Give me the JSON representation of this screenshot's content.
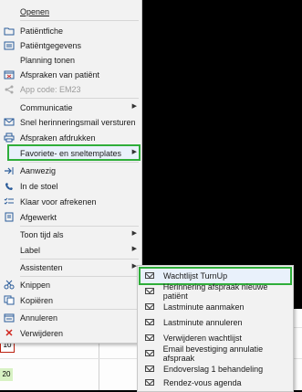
{
  "background": {
    "tag_red": "10",
    "tag_green": "20"
  },
  "menu": {
    "items": [
      {
        "label": "Openen",
        "icon": "none"
      },
      {
        "label": "Patiëntfiche",
        "icon": "folder-open-icon"
      },
      {
        "label": "Patiëntgegevens",
        "icon": "list-icon"
      },
      {
        "label": "Planning tonen",
        "icon": "none"
      },
      {
        "label": "Afspraken van patiënt",
        "icon": "calendar-icon"
      },
      {
        "label": "App code: EM23",
        "icon": "share-icon",
        "disabled": true
      },
      {
        "label": "Communicatie",
        "icon": "none"
      },
      {
        "label": "Snel herinneringsmail versturen",
        "icon": "mail-icon"
      },
      {
        "label": "Afspraken afdrukken",
        "icon": "print-icon"
      },
      {
        "label": "Favoriete- en sneltemplates",
        "icon": "none"
      },
      {
        "label": "Aanwezig",
        "icon": "arrow-in-icon"
      },
      {
        "label": "In de stoel",
        "icon": "phone-icon"
      },
      {
        "label": "Klaar voor afrekenen",
        "icon": "checklist-icon"
      },
      {
        "label": "Afgewerkt",
        "icon": "document-icon"
      },
      {
        "label": "Toon tijd als",
        "icon": "none"
      },
      {
        "label": "Label",
        "icon": "none"
      },
      {
        "label": "Assistenten",
        "icon": "none"
      },
      {
        "label": "Knippen",
        "icon": "scissors-icon"
      },
      {
        "label": "Kopiëren",
        "icon": "copy-icon"
      },
      {
        "label": "Annuleren",
        "icon": "calendar-cancel-icon"
      },
      {
        "label": "Verwijderen",
        "icon": "delete-x-icon"
      }
    ]
  },
  "submenu": {
    "items": [
      "Wachtlijst TurnUp",
      "Herinnering afspraak nieuwe patiënt",
      "Lastminute aanmaken",
      "Lastminute annuleren",
      "Verwijderen wachtlijst",
      "Email bevestiging annulatie afspraak",
      "Endoverslag 1 behandeling",
      "Rendez-vous agenda"
    ]
  },
  "colors": {
    "highlight_border": "#2fae3a",
    "menu_bg": "#f2f2f2",
    "icon_blue": "#2b5c9a",
    "delete_red": "#d0241c"
  }
}
